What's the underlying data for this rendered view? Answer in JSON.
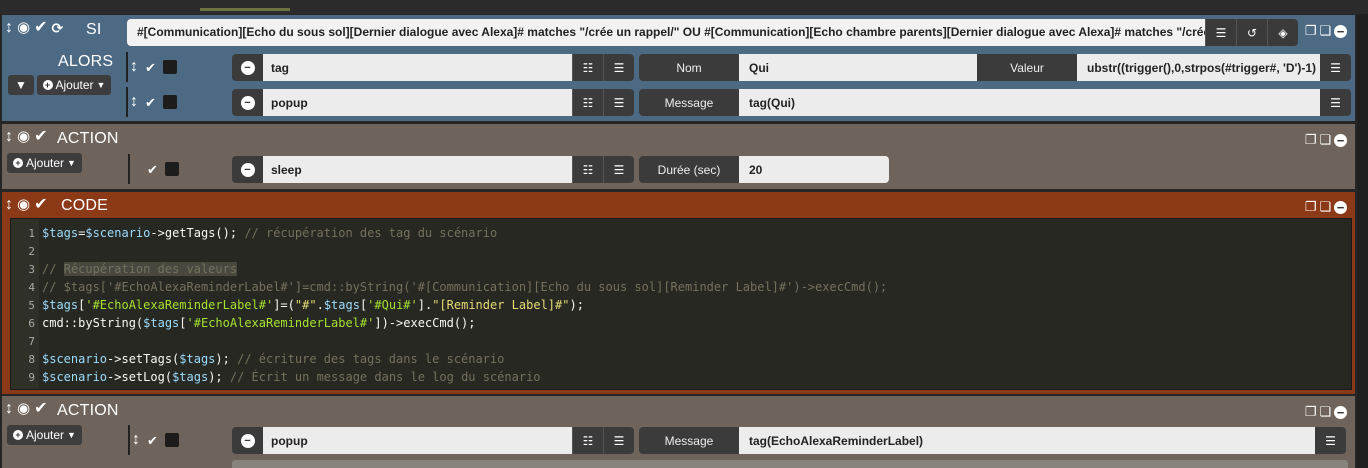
{
  "si_block": {
    "title": "SI",
    "alors_label": "ALORS",
    "add_label": "Ajouter",
    "condition": "#[Communication][Echo du sous sol][Dernier dialogue avec Alexa]# matches \"/crée un rappel/\" OU #[Communication][Echo chambre parents][Dernier dialogue avec Alexa]# matches \"/crée un rappel/",
    "actions": [
      {
        "name": "tag",
        "options": [
          {
            "label": "Nom",
            "value": "Qui"
          },
          {
            "label": "Valeur",
            "value": "ubstr((trigger(),0,strpos(#trigger#, 'D')-1)"
          }
        ]
      },
      {
        "name": "popup",
        "options": [
          {
            "label": "Message",
            "value": "tag(Qui)"
          }
        ]
      }
    ]
  },
  "action_block_1": {
    "title": "ACTION",
    "add_label": "Ajouter",
    "action": {
      "name": "sleep",
      "option_label": "Durée (sec)",
      "option_value": "20"
    }
  },
  "code_block": {
    "title": "CODE",
    "lines": [
      {
        "n": "1",
        "text": "$tags=$scenario->getTags(); // récupération des tag du scénario"
      },
      {
        "n": "2",
        "text": ""
      },
      {
        "n": "3",
        "text": "// Récupération des valeurs"
      },
      {
        "n": "4",
        "text": "// $tags['#EchoAlexaReminderLabel#']=cmd::byString('#[Communication][Echo du sous sol][Reminder Label]#')->execCmd();"
      },
      {
        "n": "5",
        "text": "$tags['#EchoAlexaReminderLabel#']=(\"#\".$tags['#Qui#'].\"[Reminder Label]#\");"
      },
      {
        "n": "6",
        "text": "cmd::byString($tags['#EchoAlexaReminderLabel#'])->execCmd();"
      },
      {
        "n": "7",
        "text": ""
      },
      {
        "n": "8",
        "text": "$scenario->setTags($tags); // écriture des tags dans le scénario"
      },
      {
        "n": "9",
        "text": "$scenario->setLog($tags); // Écrit un message dans le log du scénario"
      }
    ]
  },
  "action_block_2": {
    "title": "ACTION",
    "add_label": "Ajouter",
    "action": {
      "name": "popup",
      "option_label": "Message",
      "option_value": "tag(EchoAlexaReminderLabel)"
    }
  },
  "colors": {
    "si_bg": "#4d6a84",
    "action_bg": "#6e645b",
    "code_bg": "#8c3918",
    "editor_bg": "#272822"
  },
  "icons": [
    "move-icon",
    "eye-icon",
    "check-icon",
    "sync-icon",
    "list-check-icon",
    "list-icon",
    "history-icon",
    "cube-icon",
    "copy-icon",
    "paste-icon",
    "remove-icon",
    "plus-icon",
    "caret-down-icon"
  ]
}
